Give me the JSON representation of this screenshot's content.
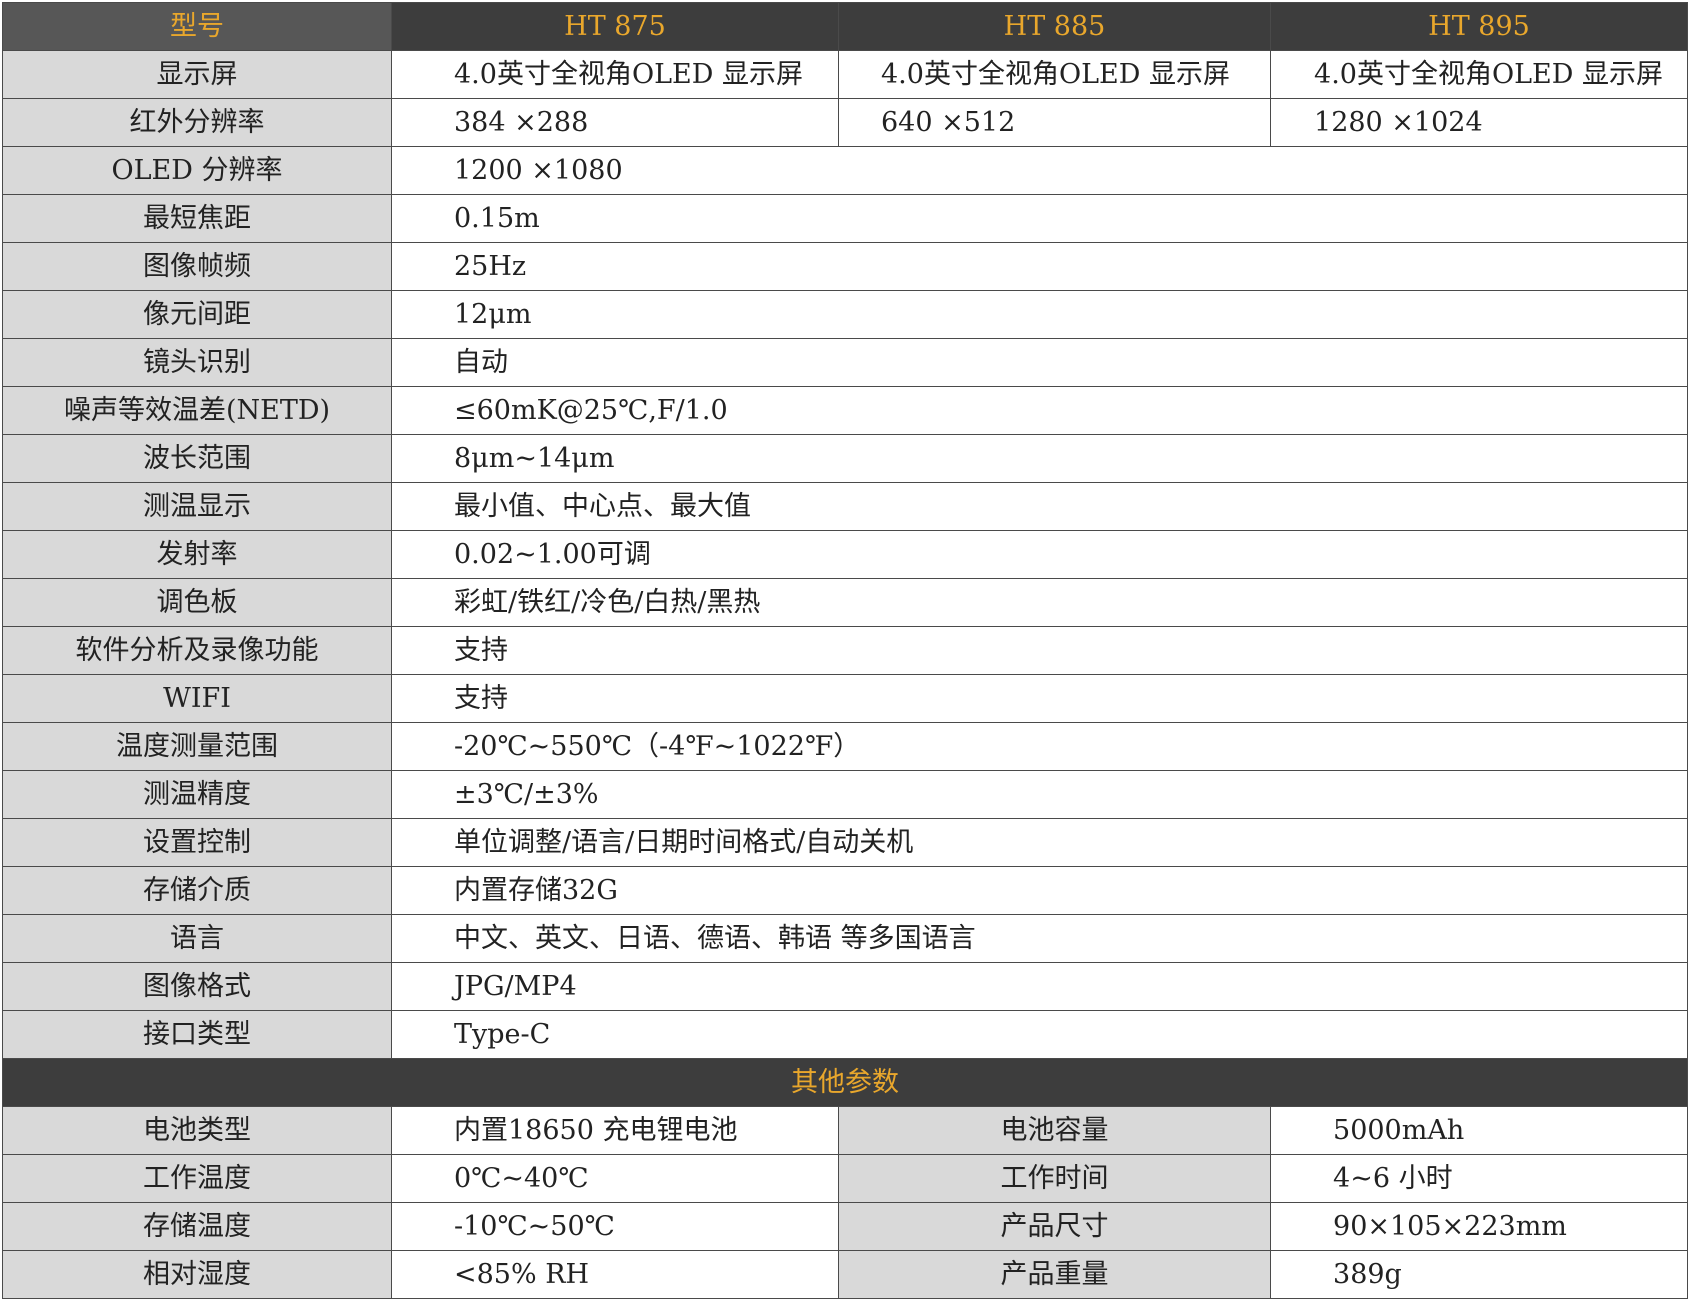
{
  "header": {
    "label": "型号",
    "models": [
      "HT 875",
      "HT 885",
      "HT 895"
    ]
  },
  "model_rows": [
    {
      "label": "显示屏",
      "values": [
        "4.0英寸全视角OLED 显示屏",
        "4.0英寸全视角OLED 显示屏",
        "4.0英寸全视角OLED 显示屏"
      ]
    },
    {
      "label": "红外分辨率",
      "values": [
        "384 ×288",
        "640 ×512",
        "1280 ×1024"
      ]
    }
  ],
  "common_rows": [
    {
      "label": "OLED 分辨率",
      "value": "1200 ×1080"
    },
    {
      "label": "最短焦距",
      "value": "0.15m"
    },
    {
      "label": "图像帧频",
      "value": "25Hz"
    },
    {
      "label": "像元间距",
      "value": "12μm"
    },
    {
      "label": "镜头识别",
      "value": "自动"
    },
    {
      "label": "噪声等效温差(NETD)",
      "value": "≤60mK@25℃,F/1.0"
    },
    {
      "label": "波长范围",
      "value": "8μm~14μm"
    },
    {
      "label": "测温显示",
      "value": "最小值、中心点、最大值"
    },
    {
      "label": "发射率",
      "value": "0.02~1.00可调"
    },
    {
      "label": "调色板",
      "value": "彩虹/铁红/冷色/白热/黑热"
    },
    {
      "label": "软件分析及录像功能",
      "value": "支持"
    },
    {
      "label": "WIFI",
      "value": "支持"
    },
    {
      "label": "温度测量范围",
      "value": "-20℃~550℃（-4℉~1022℉）"
    },
    {
      "label": "测温精度",
      "value": "±3℃/±3%"
    },
    {
      "label": "设置控制",
      "value": "单位调整/语言/日期时间格式/自动关机"
    },
    {
      "label": "存储介质",
      "value": "内置存储32G"
    },
    {
      "label": "语言",
      "value": "中文、英文、日语、德语、韩语 等多国语言"
    },
    {
      "label": "图像格式",
      "value": "JPG/MP4"
    },
    {
      "label": "接口类型",
      "value": "Type-C"
    }
  ],
  "other_section": {
    "title": "其他参数",
    "rows": [
      {
        "label1": "电池类型",
        "value1": "内置18650 充电锂电池",
        "label2": "电池容量",
        "value2": "5000mAh"
      },
      {
        "label1": "工作温度",
        "value1": "0℃~40℃",
        "label2": "工作时间",
        "value2": "4~6 小时"
      },
      {
        "label1": "存储温度",
        "value1": "-10℃~50℃",
        "label2": "产品尺寸",
        "value2": "90×105×223mm"
      },
      {
        "label1": "相对湿度",
        "value1": "<85% RH",
        "label2": "产品重量",
        "value2": "389g"
      }
    ]
  }
}
